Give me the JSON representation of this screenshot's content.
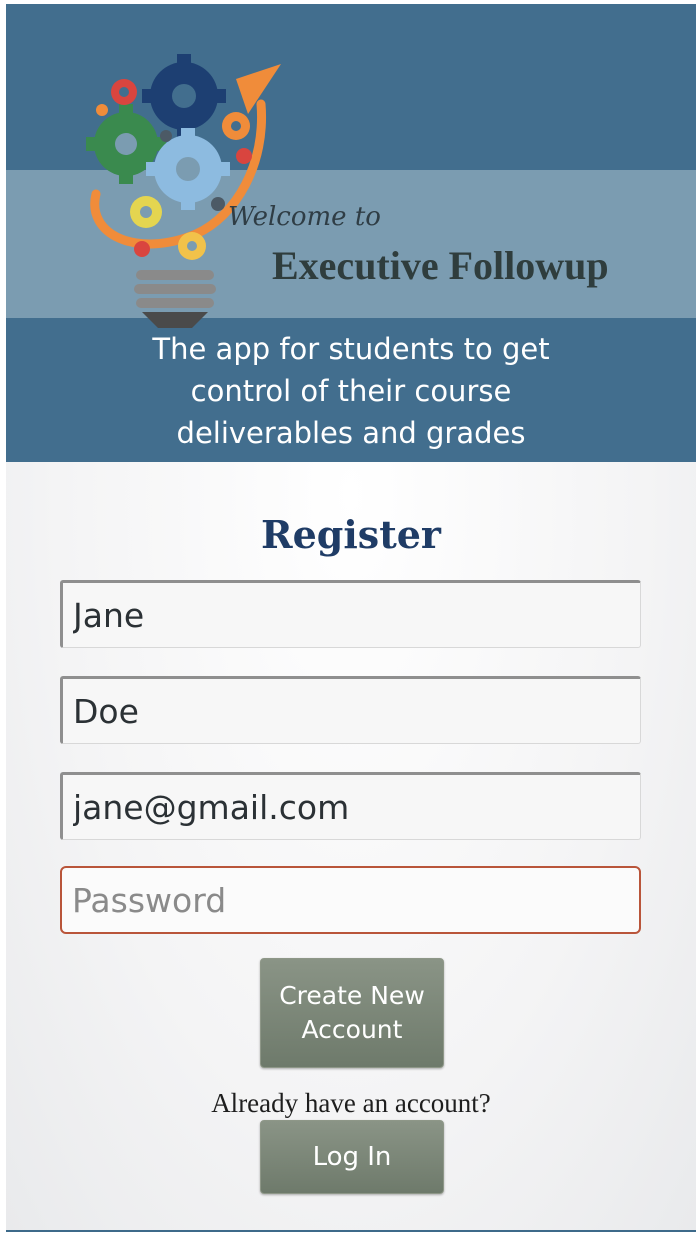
{
  "header": {
    "welcome_small": "Welcome to",
    "app_name": "Executive Followup",
    "tagline_line1": "The app for students to get",
    "tagline_line2": "control of their course",
    "tagline_line3": "deliverables and grades",
    "logo_icon": "lightbulb-gears-icon",
    "colors": {
      "header": "#426e8e",
      "band": "#7b9cb1",
      "accent_arrow": "#f08c3a"
    }
  },
  "form": {
    "title": "Register",
    "first_name": {
      "value": "Jane",
      "placeholder": ""
    },
    "last_name": {
      "value": "Doe",
      "placeholder": ""
    },
    "email": {
      "value": "jane@gmail.com",
      "placeholder": ""
    },
    "password": {
      "value": "",
      "placeholder": "Password"
    },
    "create_button": "Create New Account",
    "already_text": "Already have an account?",
    "login_button": "Log In",
    "colors": {
      "title": "#1f3c66",
      "button": "#7a8577",
      "focus_border": "#b9553a"
    }
  }
}
